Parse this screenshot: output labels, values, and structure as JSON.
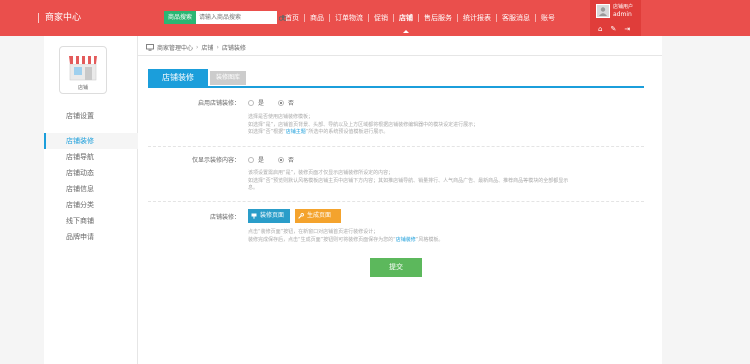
{
  "header": {
    "brand": "商家中心",
    "search_type": "商品搜索",
    "search_placeholder": "请输入商品搜索",
    "nav": [
      {
        "label": "首页"
      },
      {
        "label": "商品"
      },
      {
        "label": "订单物流"
      },
      {
        "label": "促销"
      },
      {
        "label": "店铺",
        "active": true
      },
      {
        "label": "售后服务"
      },
      {
        "label": "统计报表"
      },
      {
        "label": "客服消息"
      },
      {
        "label": "账号"
      }
    ],
    "user": {
      "role": "店铺用户",
      "name": "admin"
    }
  },
  "sidebar": {
    "logo_label": "店铺",
    "items": [
      {
        "label": "店铺设置"
      },
      {
        "label": "店铺装修",
        "active": true
      },
      {
        "label": "店铺导航"
      },
      {
        "label": "店铺动态"
      },
      {
        "label": "店铺信息"
      },
      {
        "label": "店铺分类"
      },
      {
        "label": "线下商铺"
      },
      {
        "label": "品牌申请"
      }
    ]
  },
  "breadcrumb": [
    "商家管理中心",
    "店铺",
    "店铺装修"
  ],
  "tabs": {
    "primary": "店铺装修",
    "secondary": "装修图库"
  },
  "form": {
    "field1": {
      "label": "启用店铺装修：",
      "options": [
        "是",
        "否"
      ],
      "selected": "否",
      "help": [
        "选择是否使用店铺装修模板；",
        "如选择“是”，店铺首页背景、头部、导航以及上方区域都将根据店铺装修编辑器中的模块设定进行展示；",
        "如选择“否”根据“店铺主题”所选中的系统预设值模板进行展示。"
      ],
      "help_highlight": "店铺主题"
    },
    "field2": {
      "label": "仅显示装修内容：",
      "options": [
        "是",
        "否"
      ],
      "selected": "否",
      "help": [
        "该项设置需启用“是”，装修页面才仅显示店铺装修所设定的内容；",
        "如选择“否”预览则默认风格模板店铺主页中店铺下方内容；其如推店铺导航、销量排行、人气商品广告、最新商品、推荐商品等模块的全部都显示",
        "息。"
      ]
    },
    "field3": {
      "label": "店铺装修：",
      "edit_button": "装修页面",
      "generate_button": "生成页面",
      "help": [
        "点击“装修页面”按钮，在新窗口对店铺首页进行装修设计；",
        "装修完成保存后，点击“生成页面”按钮则可将装修页面保存为您的“店铺装修”风格模板。"
      ],
      "help_highlight": "店铺装修"
    },
    "submit": "提交"
  },
  "colors": {
    "header": "#ea4f4c",
    "accent": "#1b9edb",
    "success": "#5cb85c",
    "warning": "#f4a32d"
  }
}
